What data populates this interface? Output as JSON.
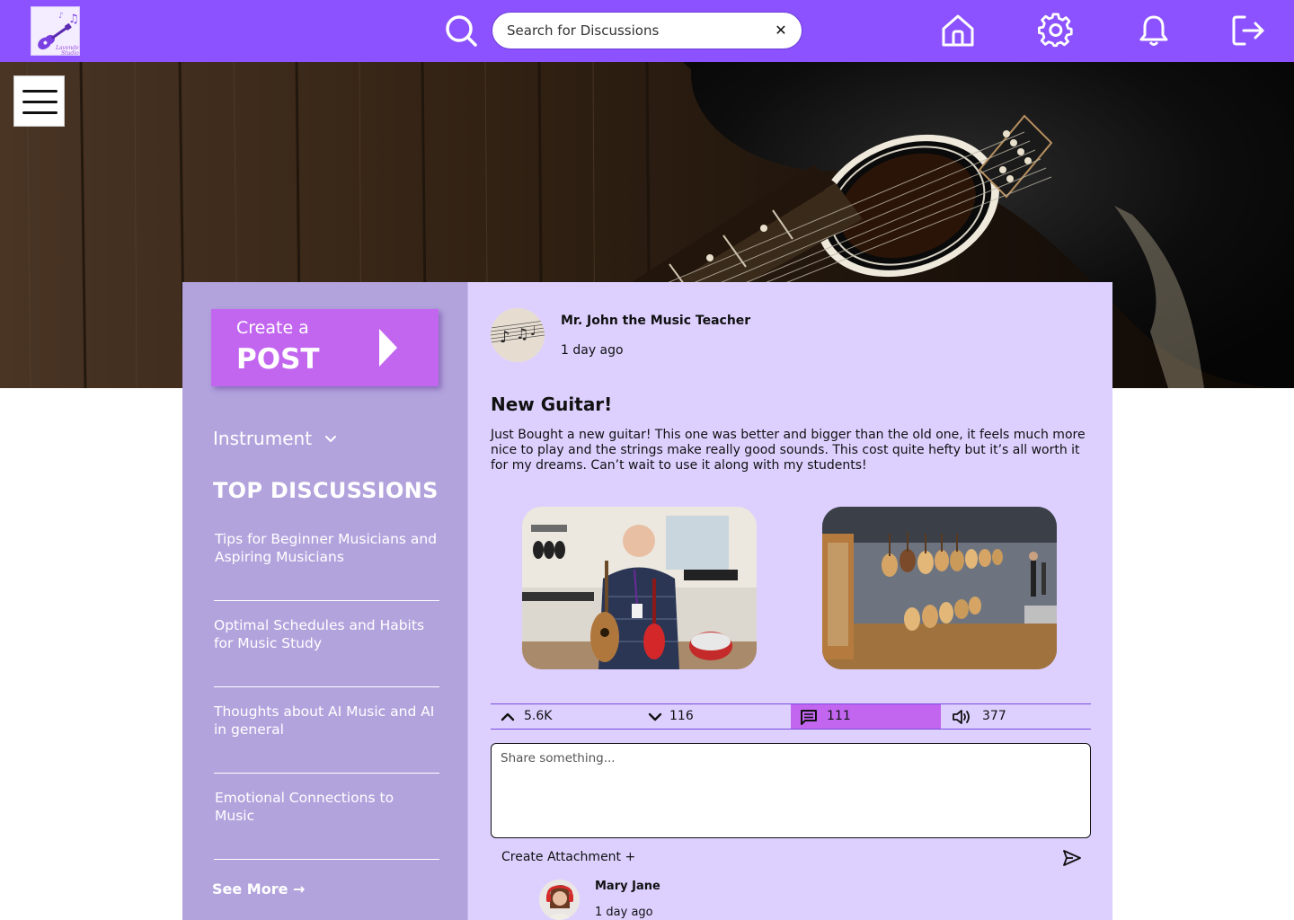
{
  "header": {
    "logo_text": "Lavender Studio",
    "search": {
      "placeholder": "Search for Discussions",
      "clear_label": "✕"
    },
    "nav_icons": [
      "home-icon",
      "gear-icon",
      "bell-icon",
      "logout-icon"
    ]
  },
  "sidebar": {
    "create_post": {
      "line1": "Create a",
      "line2": "POST"
    },
    "instrument_filter": "Instrument",
    "top_discussions_title": "TOP DISCUSSIONS",
    "discussions": [
      {
        "title": "Tips for Beginner Musicians and Aspiring Musicians"
      },
      {
        "title": "Optimal Schedules and Habits for Music Study"
      },
      {
        "title": "Thoughts about AI Music and AI in general"
      },
      {
        "title": "Emotional Connections to Music"
      }
    ],
    "see_more": "See More →"
  },
  "post": {
    "author": "Mr. John the Music Teacher",
    "time": "1 day ago",
    "title": "New Guitar!",
    "body": "Just Bought a new guitar! This one was better and bigger than the old one, it feels much more nice to play and the strings make really good sounds.  This cost quite hefty but it’s all worth it for my dreams. Can’t wait to use it along with my students!",
    "stats": {
      "upvotes": "5.6K",
      "downvotes": "116",
      "comments": "111",
      "listens": "377"
    }
  },
  "composer": {
    "placeholder": "Share something...",
    "attachment_label": "Create Attachment +"
  },
  "comment": {
    "author": "Mary Jane",
    "time": "1 day ago"
  },
  "colors": {
    "header_bg": "#8c52ff",
    "sidebar_bg": "#b3a3dd",
    "panel_bg": "#ddd0ff",
    "create_post_bg": "#c266f0",
    "active_stat_bg": "#c266f0"
  }
}
